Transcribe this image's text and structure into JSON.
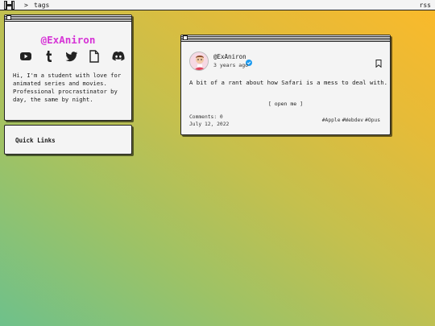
{
  "topbar": {
    "logo_icon": "h-logo-icon",
    "separator": ">",
    "section": "tags",
    "rss_label": "rss"
  },
  "profile": {
    "handle": "@ExAniron",
    "handle_color": "#d633d6",
    "socials": [
      "youtube-icon",
      "tumblr-icon",
      "twitter-icon",
      "document-icon",
      "discord-icon"
    ],
    "bio": "Hi, I'm a student with love for animated series and movies. Professional procrastinator by day, the same by night."
  },
  "quick_links": {
    "title": "Quick Links"
  },
  "post": {
    "author": "@ExAniron",
    "verified_color": "#1d9bf0",
    "time_ago": "3 years ago",
    "text": "A bit of a rant about how Safari is a mess to deal with.",
    "open_label": "[ open me ]",
    "comments": "Comments: 0",
    "date": "July 12, 2022",
    "tags": [
      "#Apple",
      "#Webdev",
      "#Opus"
    ]
  }
}
